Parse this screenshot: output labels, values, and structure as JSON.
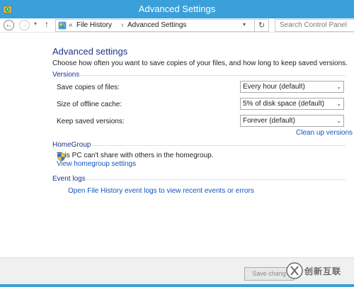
{
  "window": {
    "title": "Advanced Settings"
  },
  "address_bar": {
    "back_glyph": "←",
    "forward_glyph": "→",
    "dropdown_glyph": "▾",
    "up_glyph": "↑",
    "crumb_prefix": "«",
    "crumbs": [
      "File History",
      "Advanced Settings"
    ],
    "crumb_separator": "›",
    "breadcrumb_dropdown_glyph": "▾",
    "refresh_glyph": "↻",
    "search_placeholder": "Search Control Panel"
  },
  "main": {
    "heading": "Advanced settings",
    "intro": "Choose how often you want to save copies of your files, and how long to keep saved versions.",
    "versions": {
      "title": "Versions",
      "rows": [
        {
          "label": "Save copies of files:",
          "value": "Every hour (default)"
        },
        {
          "label": "Size of offline cache:",
          "value": "5% of disk space (default)"
        },
        {
          "label": "Keep saved versions:",
          "value": "Forever (default)"
        }
      ],
      "select_chevron": "⌄",
      "cleanup_link": "Clean up versions"
    },
    "homegroup": {
      "title": "HomeGroup",
      "status": "This PC can't share with others in the homegroup.",
      "link": "View homegroup settings"
    },
    "event_logs": {
      "title": "Event logs",
      "link": "Open File History event logs to view recent events or errors"
    }
  },
  "footer": {
    "save_button_label": "Save chang"
  },
  "watermark": {
    "text": "创新互联"
  },
  "icons": {
    "app": "file-history-icon",
    "address": "control-panel-icon",
    "event_logs": "shield-icon",
    "watermark": "logo-icon"
  },
  "colors": {
    "titlebar": "#3aa0d9",
    "heading": "#1e3287",
    "link": "#0f55bd"
  }
}
